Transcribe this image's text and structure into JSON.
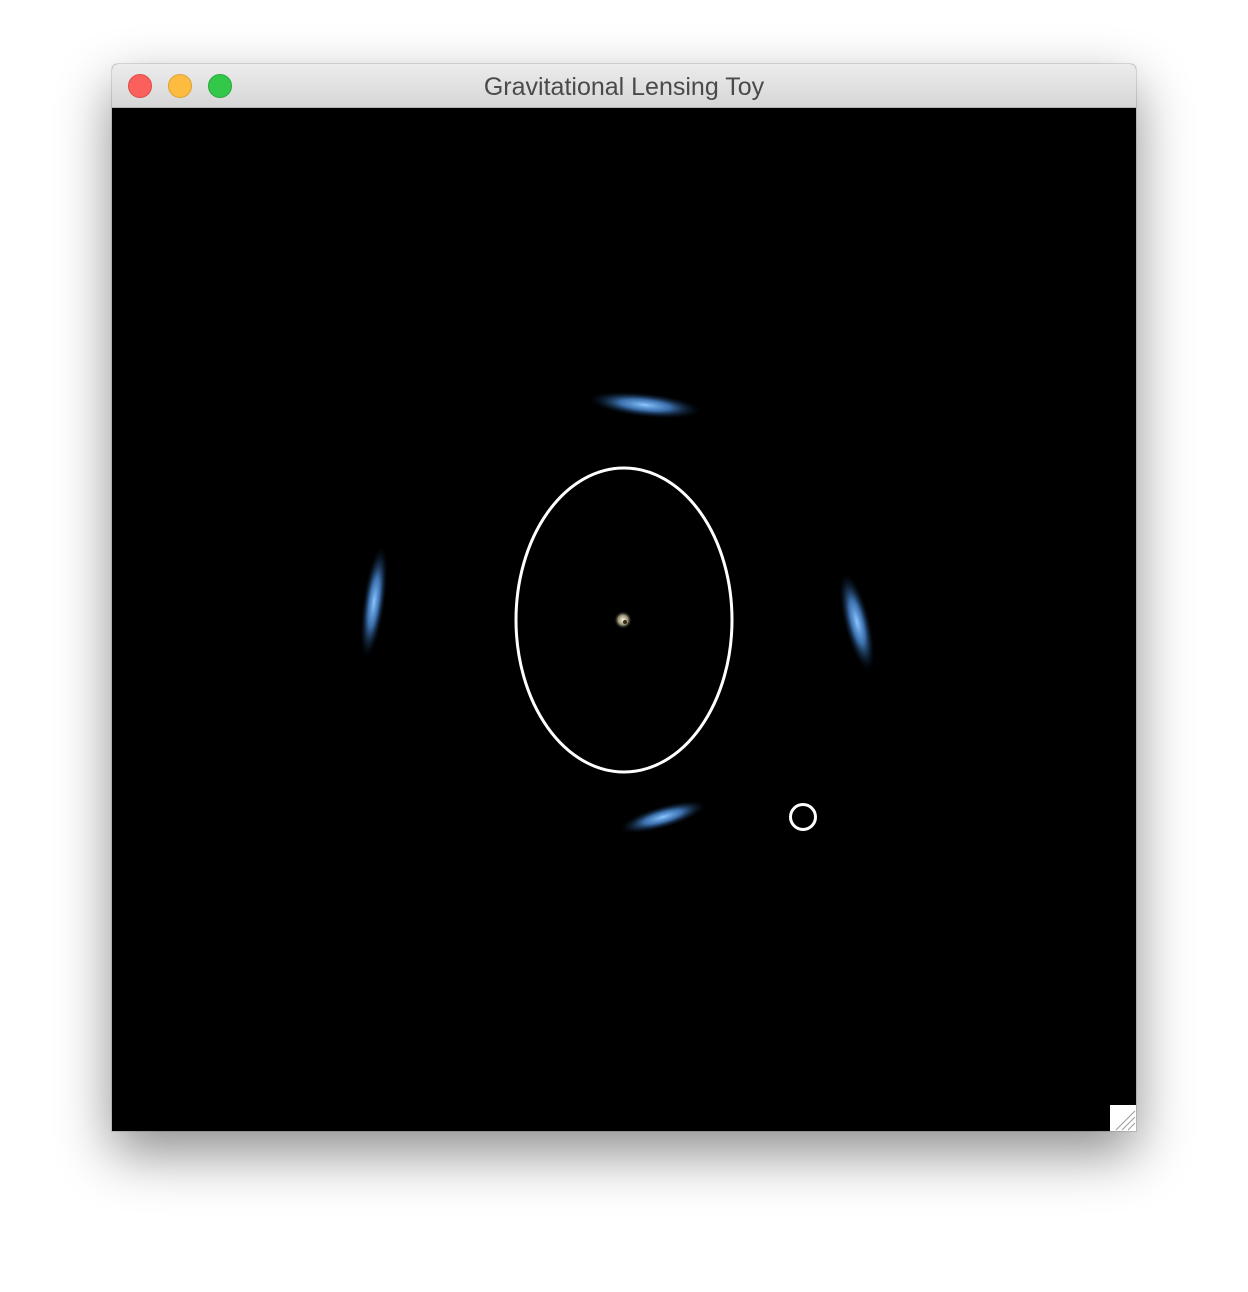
{
  "window": {
    "title": "Gravitational Lensing Toy"
  },
  "colors": {
    "background": "#000000",
    "lensed_image": "#6fb0ff",
    "caustic": "#ffffff"
  },
  "icons": {
    "close": "close-icon",
    "minimize": "minimize-icon",
    "zoom": "zoom-icon",
    "resize": "resize-grip-icon"
  }
}
